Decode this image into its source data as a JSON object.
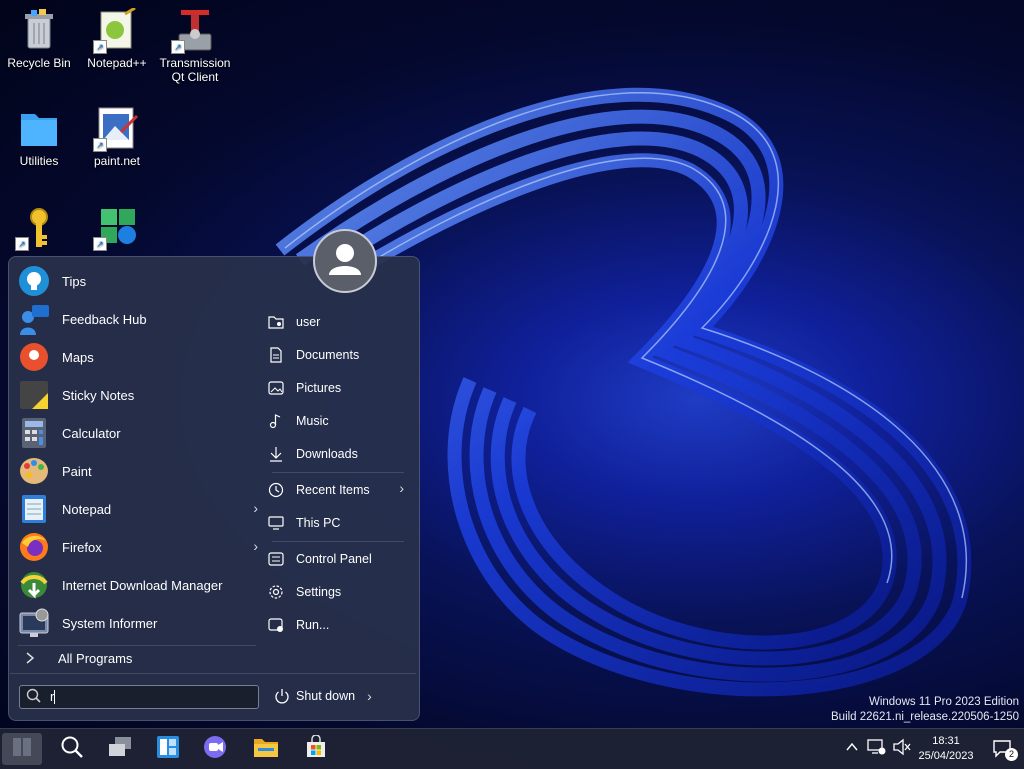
{
  "desktop": {
    "icons": [
      {
        "label": "Recycle Bin",
        "icon": "recycle-bin-icon"
      },
      {
        "label": "Notepad++",
        "icon": "notepadpp-icon"
      },
      {
        "label": "Transmission Qt Client",
        "icon": "transmission-icon"
      },
      {
        "label": "Utilities",
        "icon": "folder-icon"
      },
      {
        "label": "paint.net",
        "icon": "paintnet-icon"
      },
      {
        "label": "",
        "icon": "key-icon"
      },
      {
        "label": "",
        "icon": "app-leaf-icon"
      }
    ]
  },
  "start_menu": {
    "programs": [
      {
        "label": "Tips",
        "icon": "tips-icon",
        "has_submenu": false
      },
      {
        "label": "Feedback Hub",
        "icon": "feedback-hub-icon",
        "has_submenu": false
      },
      {
        "label": "Maps",
        "icon": "maps-icon",
        "has_submenu": false
      },
      {
        "label": "Sticky Notes",
        "icon": "sticky-notes-icon",
        "has_submenu": false
      },
      {
        "label": "Calculator",
        "icon": "calculator-icon",
        "has_submenu": false
      },
      {
        "label": "Paint",
        "icon": "paint-icon",
        "has_submenu": false
      },
      {
        "label": "Notepad",
        "icon": "notepad-icon",
        "has_submenu": true
      },
      {
        "label": "Firefox",
        "icon": "firefox-icon",
        "has_submenu": true
      },
      {
        "label": "Internet Download Manager",
        "icon": "idm-icon",
        "has_submenu": false
      },
      {
        "label": "System Informer",
        "icon": "system-informer-icon",
        "has_submenu": false
      }
    ],
    "all_programs_label": "All Programs",
    "places": [
      {
        "label": "user",
        "icon": "user-folder-icon",
        "has_submenu": false
      },
      {
        "label": "Documents",
        "icon": "document-icon",
        "has_submenu": false
      },
      {
        "label": "Pictures",
        "icon": "picture-icon",
        "has_submenu": false
      },
      {
        "label": "Music",
        "icon": "music-icon",
        "has_submenu": false
      },
      {
        "label": "Downloads",
        "icon": "download-icon",
        "has_submenu": false
      },
      {
        "label": "Recent Items",
        "icon": "clock-icon",
        "has_submenu": true
      },
      {
        "label": "This PC",
        "icon": "computer-icon",
        "has_submenu": false
      },
      {
        "label": "Control Panel",
        "icon": "control-panel-icon",
        "has_submenu": false
      },
      {
        "label": "Settings",
        "icon": "gear-icon",
        "has_submenu": false
      },
      {
        "label": "Run...",
        "icon": "run-icon",
        "has_submenu": false
      }
    ],
    "search": {
      "value": "r",
      "placeholder": ""
    },
    "shutdown_label": "Shut down"
  },
  "taskbar": {
    "buttons": [
      "start-button-icon",
      "search-icon",
      "task-view-icon",
      "widgets-icon",
      "chat-icon",
      "file-explorer-icon",
      "store-icon"
    ],
    "tray": {
      "time": "18:31",
      "date": "25/04/2023",
      "notification_count": "2"
    }
  },
  "watermark": {
    "line1": "Windows 11 Pro 2023 Edition",
    "line2": "Build 22621.ni_release.220506-1250"
  }
}
